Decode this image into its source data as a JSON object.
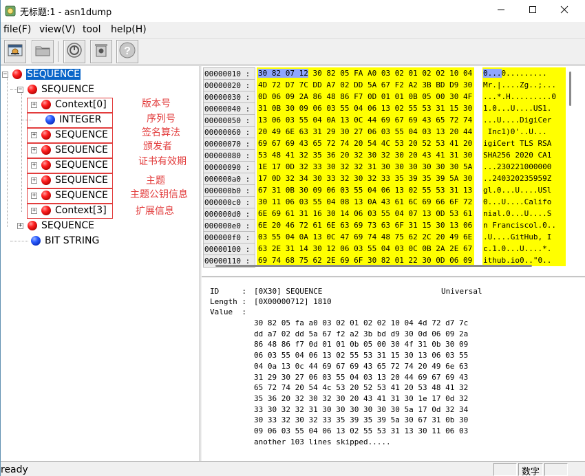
{
  "window": {
    "title": "无标题:1 - asn1dump",
    "minimize_icon": "minimize-icon",
    "maximize_icon": "maximize-icon",
    "close_icon": "close-icon"
  },
  "menu": [
    "file(F)",
    "view(V)",
    "tool",
    "help(H)"
  ],
  "toolbar": {
    "buttons": [
      "edit-icon",
      "open-folder-icon",
      "power-icon",
      "recycle-icon",
      "help-icon"
    ]
  },
  "tree": {
    "root": "SEQUENCE",
    "child_sequence": "SEQUENCE",
    "items": [
      "Context[0]",
      "INTEGER",
      "SEQUENCE",
      "SEQUENCE",
      "SEQUENCE",
      "SEQUENCE",
      "SEQUENCE",
      "Context[3]"
    ],
    "sibling_sequence": "SEQUENCE",
    "bit_string": "BIT STRING",
    "annotations": [
      "版本号",
      "序列号",
      "签名算法",
      "颁发者",
      "证书有效期",
      "主题",
      "主题公钥信息",
      "扩展信息"
    ]
  },
  "hex": {
    "rows": [
      {
        "addr": "00000010 :",
        "sel": "30 82 07 12",
        "bytes": " 30 82 05 FA A0 03 02 01 02 02 10 04",
        "asel": "0...",
        "ascii": "0........."
      },
      {
        "addr": "00000020 :",
        "bytes": "4D 72 D7 7C DD A7 02 DD 5A 67 F2 A2 3B BD D9 30",
        "ascii": "Mr.|....Zg..;..."
      },
      {
        "addr": "00000030 :",
        "bytes": "0D 06 09 2A 86 48 86 F7 0D 01 01 0B 05 00 30 4F",
        "ascii": "...*.H.........0"
      },
      {
        "addr": "00000040 :",
        "bytes": "31 0B 30 09 06 03 55 04 06 13 02 55 53 31 15 30",
        "ascii": "1.0...U....US1."
      },
      {
        "addr": "00000050 :",
        "bytes": "13 06 03 55 04 0A 13 0C 44 69 67 69 43 65 72 74",
        "ascii": "...U....DigiCer"
      },
      {
        "addr": "00000060 :",
        "bytes": "20 49 6E 63 31 29 30 27 06 03 55 04 03 13 20 44",
        "ascii": " Inc1)0'..U..."
      },
      {
        "addr": "00000070 :",
        "bytes": "69 67 69 43 65 72 74 20 54 4C 53 20 52 53 41 20",
        "ascii": "igiCert TLS RSA"
      },
      {
        "addr": "00000080 :",
        "bytes": "53 48 41 32 35 36 20 32 30 32 30 20 43 41 31 30",
        "ascii": "SHA256 2020 CA1"
      },
      {
        "addr": "00000090 :",
        "bytes": "1E 17 0D 32 33 30 32 32 31 30 30 30 30 30 30 5A",
        "ascii": "...230221000000"
      },
      {
        "addr": "000000a0 :",
        "bytes": "17 0D 32 34 30 33 32 30 32 33 35 39 35 39 5A 30",
        "ascii": "..240320235959Z"
      },
      {
        "addr": "000000b0 :",
        "bytes": "67 31 0B 30 09 06 03 55 04 06 13 02 55 53 31 13",
        "ascii": "gl.0...U....USl"
      },
      {
        "addr": "000000c0 :",
        "bytes": "30 11 06 03 55 04 08 13 0A 43 61 6C 69 66 6F 72",
        "ascii": "0...U....Califo"
      },
      {
        "addr": "000000d0 :",
        "bytes": "6E 69 61 31 16 30 14 06 03 55 04 07 13 0D 53 61",
        "ascii": "nial.0...U....S"
      },
      {
        "addr": "000000e0 :",
        "bytes": "6E 20 46 72 61 6E 63 69 73 63 6F 31 15 30 13 06",
        "ascii": "n Franciscol.0.."
      },
      {
        "addr": "000000f0 :",
        "bytes": "03 55 04 0A 13 0C 47 69 74 48 75 62 2C 20 49 6E",
        "ascii": ".U....GitHub, I"
      },
      {
        "addr": "00000100 :",
        "bytes": "63 2E 31 14 30 12 06 03 55 04 03 0C 0B 2A 2E 67",
        "ascii": "c.1.0...U....*."
      },
      {
        "addr": "00000110 :",
        "bytes": "69 74 68 75 62 2E 69 6F 30 82 01 22 30 0D 06 09",
        "ascii": "ithub.io0..\"0.."
      }
    ]
  },
  "detail": {
    "id_label": "ID     :",
    "id_value": "[0X30] SEQUENCE",
    "class_value": "Universal",
    "length_label": "Length :",
    "length_value": "[0X00000712] 1810",
    "value_label": "Value  :",
    "value_lines": [
      "30 82 05 fa a0 03 02 01 02 02 10 04 4d 72 d7 7c",
      "dd a7 02 dd 5a 67 f2 a2 3b bd d9 30 0d 06 09 2a",
      "86 48 86 f7 0d 01 01 0b 05 00 30 4f 31 0b 30 09",
      "06 03 55 04 06 13 02 55 53 31 15 30 13 06 03 55",
      "04 0a 13 0c 44 69 67 69 43 65 72 74 20 49 6e 63",
      "31 29 30 27 06 03 55 04 03 13 20 44 69 67 69 43",
      "65 72 74 20 54 4c 53 20 52 53 41 20 53 48 41 32",
      "35 36 20 32 30 32 30 20 43 41 31 30 1e 17 0d 32",
      "33 30 32 32 31 30 30 30 30 30 30 5a 17 0d 32 34",
      "30 33 32 30 32 33 35 39 35 39 5a 30 67 31 0b 30",
      "09 06 03 55 04 06 13 02 55 53 31 13 30 11 06 03",
      "another 103 lines skipped....."
    ]
  },
  "status": {
    "text": "ready",
    "num_label": "数字"
  }
}
